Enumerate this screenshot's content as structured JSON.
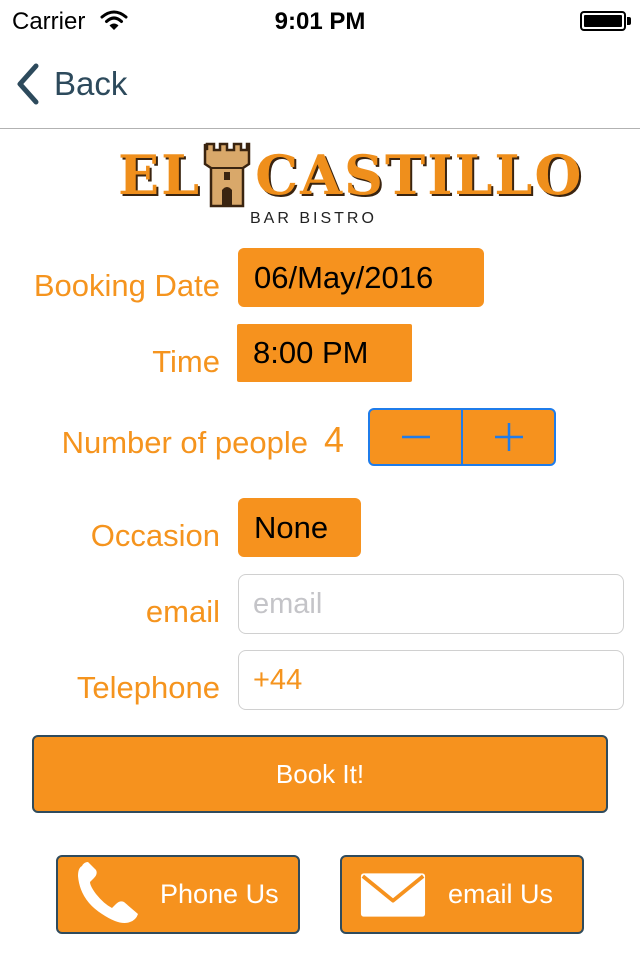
{
  "status_bar": {
    "carrier": "Carrier",
    "time": "9:01 PM"
  },
  "nav": {
    "back_label": "Back"
  },
  "logo": {
    "name_left": "EL",
    "name_right": "CASTILLO",
    "tagline": "BAR BISTRO"
  },
  "form": {
    "booking_date": {
      "label": "Booking Date",
      "value": "06/May/2016"
    },
    "time": {
      "label": "Time",
      "value": "8:00 PM"
    },
    "people": {
      "label": "Number of people",
      "value": "4"
    },
    "occasion": {
      "label": "Occasion",
      "value": "None"
    },
    "email": {
      "label": "email",
      "placeholder": "email",
      "value": ""
    },
    "telephone": {
      "label": "Telephone",
      "value": "+44"
    }
  },
  "actions": {
    "book_label": "Book It!",
    "phone_label": "Phone Us",
    "email_label": "email Us"
  },
  "colors": {
    "accent": "#f6921e",
    "label_text": "#f5941e",
    "stepper_tint": "#1f7cea",
    "button_border": "#2f4b5d"
  }
}
